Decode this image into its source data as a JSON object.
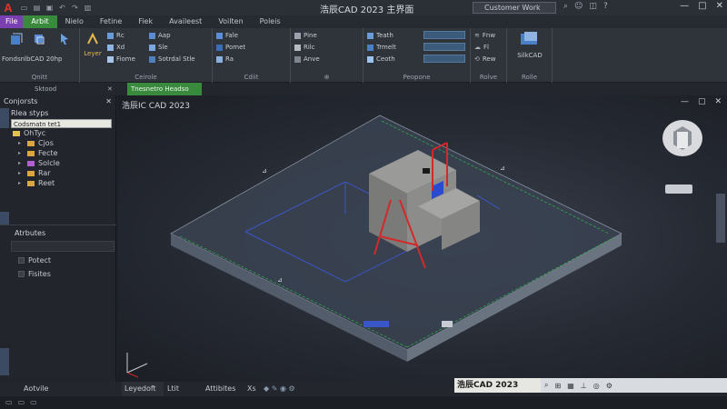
{
  "window": {
    "title": "浩辰CAD 2023 主界面",
    "workspace": "Customer Work",
    "controls": [
      "—",
      "□",
      "✕"
    ]
  },
  "tabs": [
    {
      "label": "File",
      "kind": "file"
    },
    {
      "label": "Arbit",
      "kind": "active"
    },
    {
      "label": "Nielo",
      "kind": ""
    },
    {
      "label": "Fetine",
      "kind": ""
    },
    {
      "label": "Fiek",
      "kind": ""
    },
    {
      "label": "Availeest",
      "kind": ""
    },
    {
      "label": "Voilten",
      "kind": ""
    },
    {
      "label": "Poleis",
      "kind": ""
    }
  ],
  "ribbon": {
    "groups": [
      {
        "label": "Qnitt"
      },
      {
        "label": "Ceirole"
      },
      {
        "label": "Cdiit"
      },
      {
        "label": "Peopone"
      },
      {
        "label": "Rolve"
      },
      {
        "label": "Rolle"
      }
    ],
    "big_buttons": {
      "left": "FondsnlbCAD 20hp",
      "layer": "Leyer",
      "smartcad": "SilkCAD"
    },
    "items": {
      "c1": [
        "Rc",
        "Xd",
        "Fiome"
      ],
      "c2": [
        "Aap",
        "Sle",
        "Sotrdal Stle"
      ],
      "d1": [
        "Fale",
        "Pomet",
        "Ra"
      ],
      "d2": [
        "Pine",
        "Rilc",
        "Anve"
      ],
      "p1": [
        "Teath",
        "Trmelt",
        "Ceoth"
      ],
      "r1": [
        "Fnw",
        "Fl",
        "Rew"
      ]
    }
  },
  "subbar": {
    "left_label": "Sktood",
    "doc_tab": "Tnesnetro Headso"
  },
  "components": {
    "header": "Conjorsts",
    "section": "Rlea styps",
    "selected": "Codsmatn tet1",
    "selected_sub": "OhTyc",
    "items": [
      "Cjos",
      "Fecte",
      "Solcle",
      "Rar",
      "Reet"
    ]
  },
  "attributes": {
    "header": "Atrbutes",
    "items": [
      "Potect",
      "Fisites"
    ]
  },
  "viewport": {
    "title": "浩辰IC CAD 2023"
  },
  "bottom": {
    "left": "Aotvile",
    "tabs": [
      "Leyedoft",
      "Ltit",
      "Attibites",
      "Xs"
    ]
  },
  "status": {
    "cad_label": "浩辰CAD 2023",
    "icons": [
      "magnifier-icon",
      "snap-icon",
      "grid-icon",
      "ortho-icon",
      "polar-icon",
      "settings-icon"
    ]
  },
  "colors": {
    "accent_green": "#3a8a3e",
    "file_tab": "#7a3fb0",
    "model_red": "#d22a2a",
    "model_blue": "#3a56c8",
    "model_green": "#2fa84a"
  }
}
